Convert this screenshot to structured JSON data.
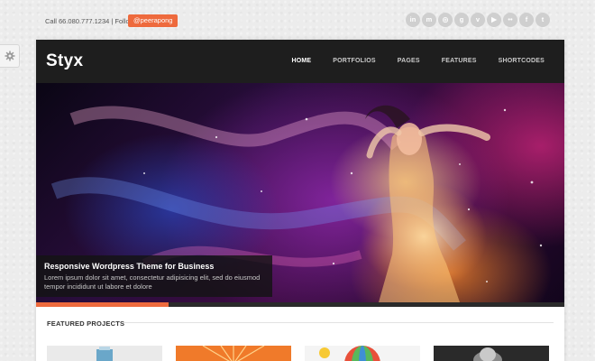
{
  "topbar": {
    "contact": "Call 66.080.777.1234 | Follow",
    "twitter_handle": "@peerapong",
    "social_icons": [
      {
        "name": "linkedin-icon",
        "glyph": "in"
      },
      {
        "name": "myspace-icon",
        "glyph": "m"
      },
      {
        "name": "dribbble-icon",
        "glyph": "◎"
      },
      {
        "name": "google-plus-icon",
        "glyph": "g"
      },
      {
        "name": "vimeo-icon",
        "glyph": "v"
      },
      {
        "name": "youtube-icon",
        "glyph": "▶"
      },
      {
        "name": "flickr-icon",
        "glyph": "••"
      },
      {
        "name": "facebook-icon",
        "glyph": "f"
      },
      {
        "name": "twitter-icon",
        "glyph": "t"
      }
    ]
  },
  "brand": {
    "logo": "Styx"
  },
  "nav": {
    "items": [
      {
        "label": "HOME",
        "active": true
      },
      {
        "label": "PORTFOLIOS",
        "active": false
      },
      {
        "label": "PAGES",
        "active": false
      },
      {
        "label": "FEATURES",
        "active": false
      },
      {
        "label": "SHORTCODES",
        "active": false
      }
    ]
  },
  "slider": {
    "caption_title": "Responsive Wordpress Theme for Business",
    "caption_text": "Lorem ipsum dolor sit amet, consectetur adipisicing elit, sed do eiusmod tempor incididunt ut labore et dolore",
    "progress": 0.25
  },
  "featured": {
    "title": "FEATURED PROJECTS"
  },
  "colors": {
    "accent": "#ee6a3d",
    "nav_bg": "#1e1e1e",
    "page_bg": "#ececec"
  }
}
